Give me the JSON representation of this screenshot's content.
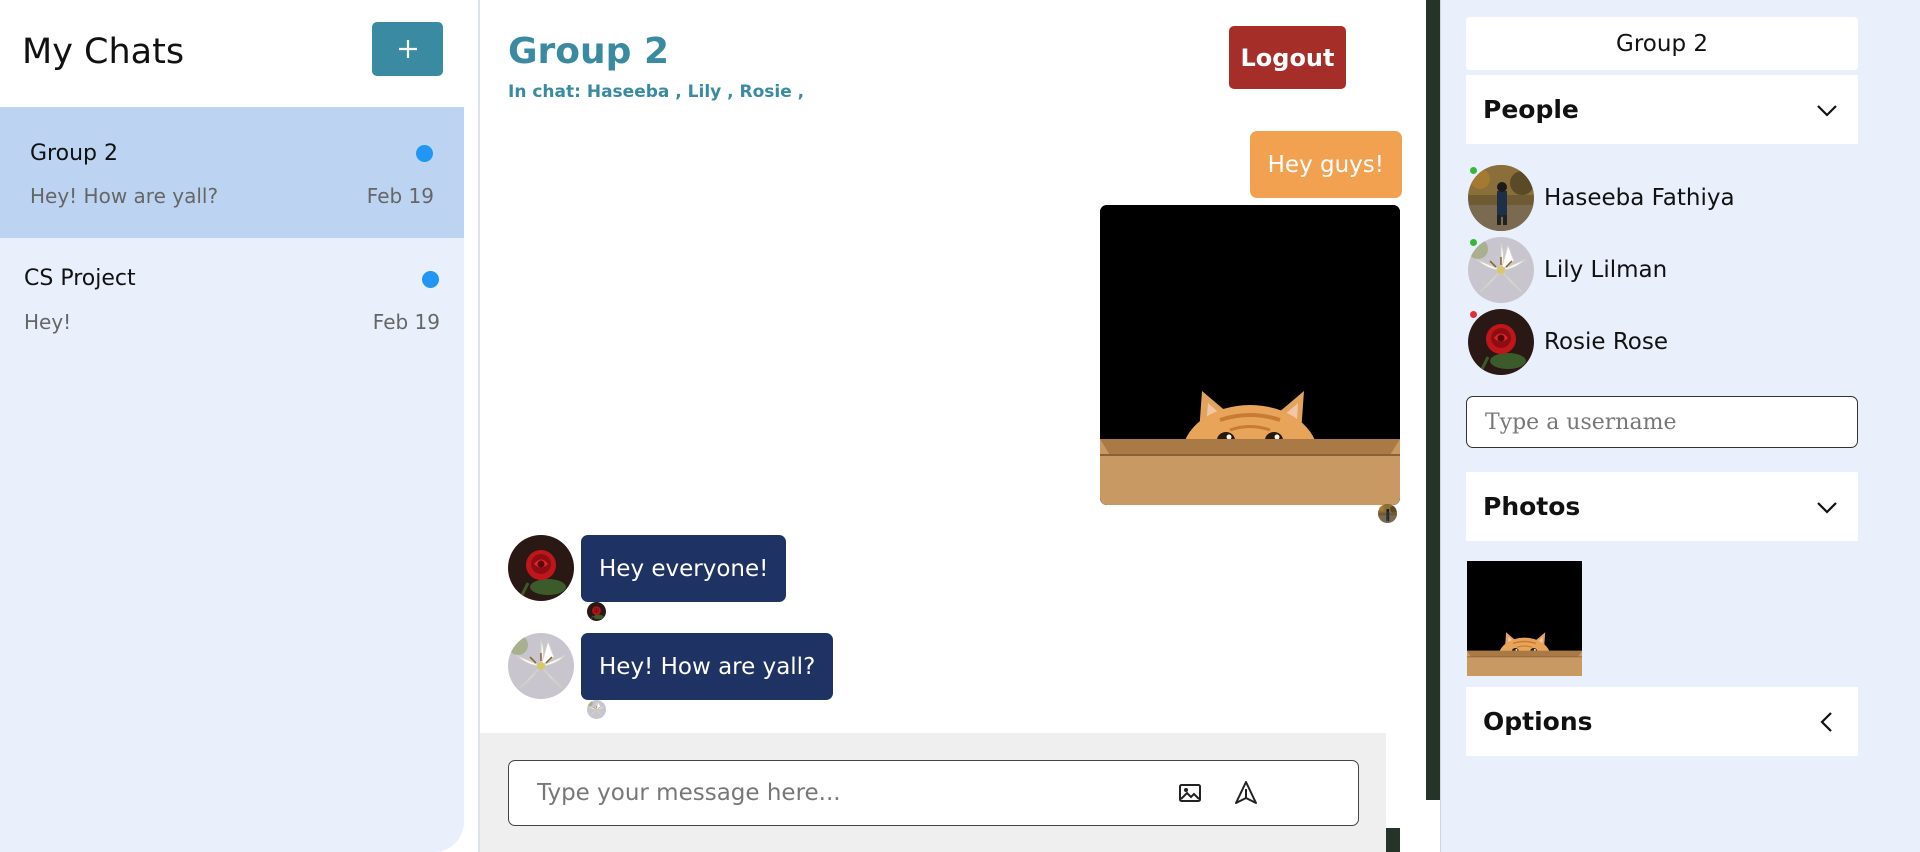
{
  "sidebar": {
    "title": "My Chats",
    "new_chat_label": "+",
    "chats": [
      {
        "name": "Group 2",
        "preview": "Hey! How are yall?",
        "date": "Feb 19"
      },
      {
        "name": "CS Project",
        "preview": "Hey!",
        "date": "Feb 19"
      }
    ]
  },
  "chat": {
    "title": "Group 2",
    "members_line": "In chat: Haseeba , Lily , Rosie ,",
    "logout_label": "Logout",
    "messages": [
      {
        "text": "Hey guys!"
      },
      {
        "text": "Hey everyone!"
      },
      {
        "text": "Hey! How are yall?"
      }
    ],
    "composer": {
      "placeholder": "Type your message here..."
    }
  },
  "details": {
    "title": "Group 2",
    "people_label": "People",
    "people": [
      {
        "name": "Haseeba Fathiya",
        "status_color": "#35b83a"
      },
      {
        "name": "Lily Lilman",
        "status_color": "#35b83a"
      },
      {
        "name": "Rosie Rose",
        "status_color": "#e03131"
      }
    ],
    "username_placeholder": "Type a username",
    "photos_label": "Photos",
    "options_label": "Options"
  },
  "colors": {
    "accent": "#3a8aa2",
    "logout": "#a52f28",
    "own_bubble": "#f2a150",
    "other_bubble": "#1e3263",
    "unread": "#2196f3"
  }
}
